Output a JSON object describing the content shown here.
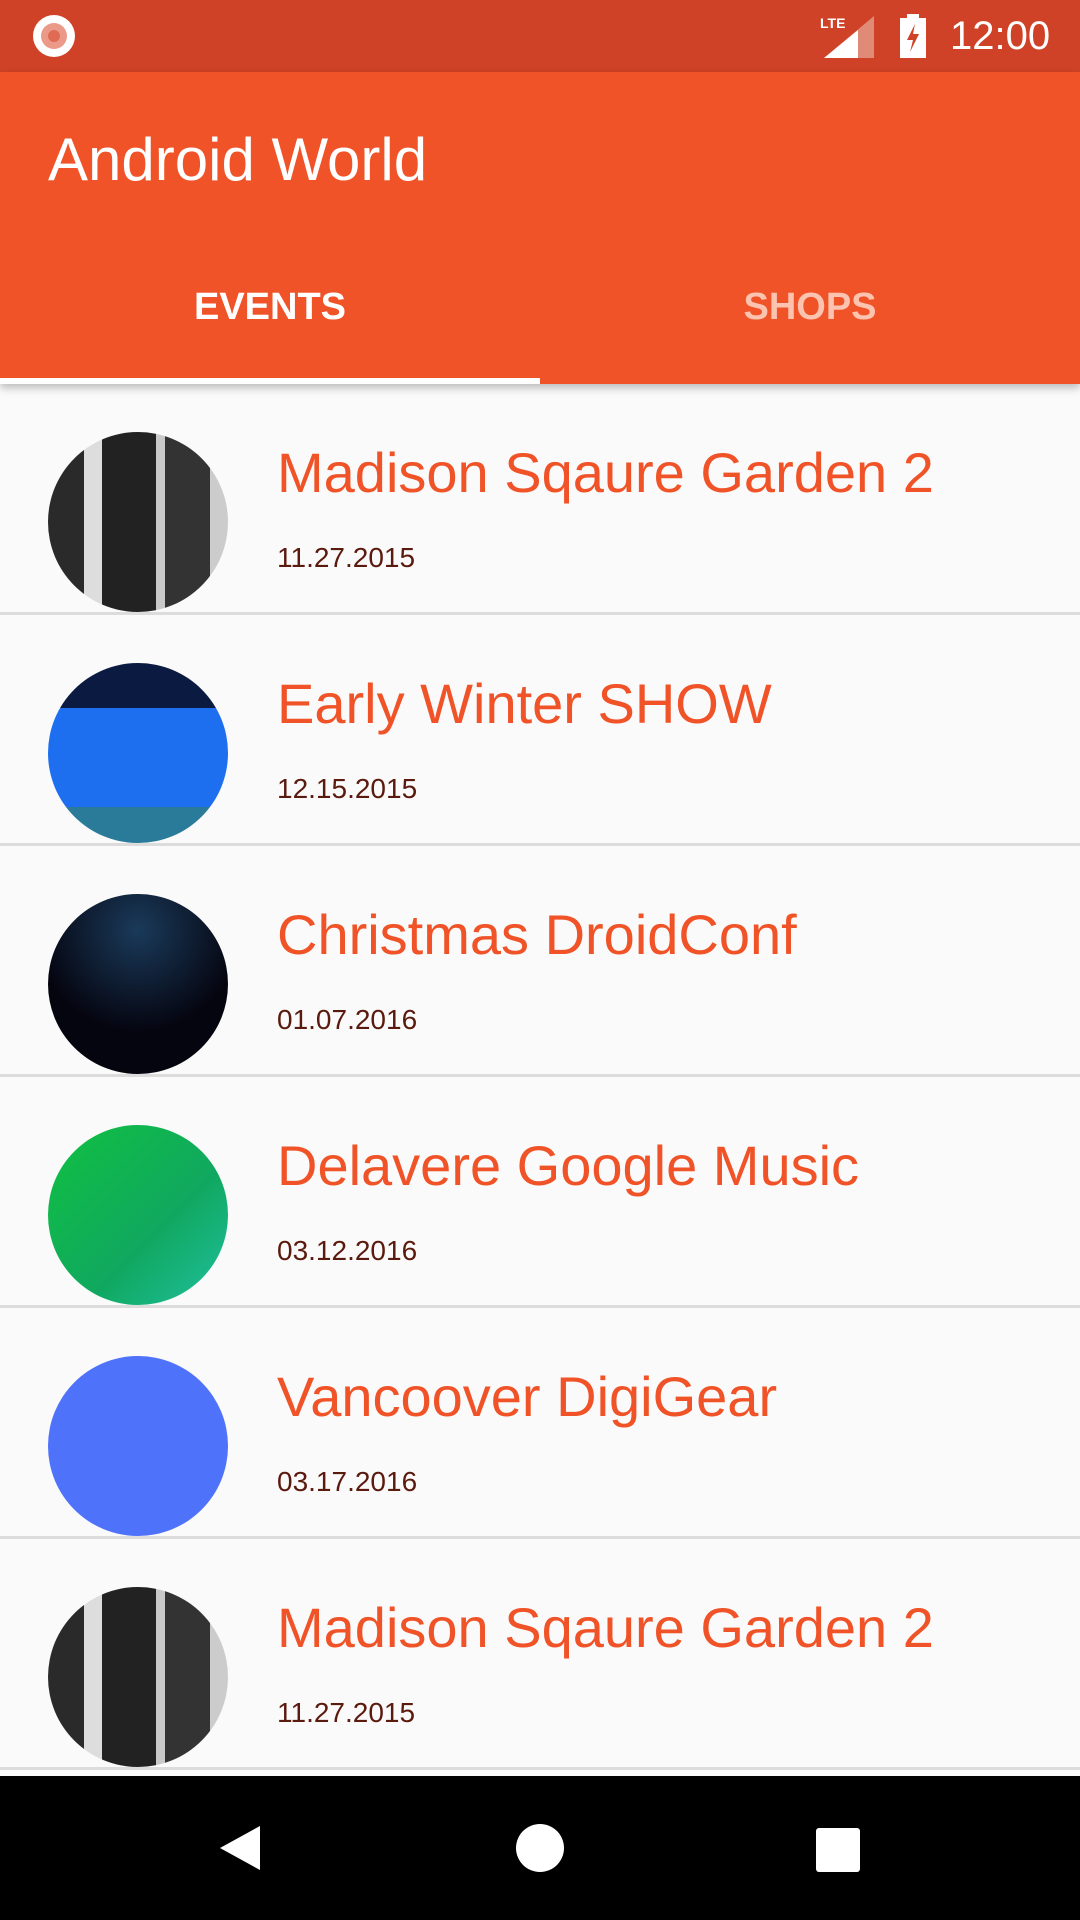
{
  "status_bar": {
    "time": "12:00",
    "network": "LTE",
    "icons": [
      "record-icon",
      "lte-signal-icon",
      "battery-charging-icon"
    ]
  },
  "app_bar": {
    "title": "Android World",
    "color": "#f05327"
  },
  "tabs": [
    {
      "label": "EVENTS",
      "selected": true
    },
    {
      "label": "SHOPS",
      "selected": false
    }
  ],
  "events": [
    {
      "title": "Madison Sqaure Garden 2",
      "date": "11.27.2015",
      "image": "people-photo"
    },
    {
      "title": "Early Winter SHOW",
      "date": "12.15.2015",
      "image": "stage-photo"
    },
    {
      "title": "Christmas DroidConf",
      "date": "01.07.2016",
      "image": "whats-next-photo"
    },
    {
      "title": "Delavere Google Music",
      "date": "03.12.2016",
      "image": "ng-conf-logo"
    },
    {
      "title": "Vancoover DigiGear",
      "date": "03.17.2016",
      "image": "io-logo"
    },
    {
      "title": "Madison Sqaure Garden 2",
      "date": "11.27.2015",
      "image": "people-photo"
    }
  ],
  "nav_bar": {
    "icons": [
      "back-icon",
      "home-icon",
      "recents-icon"
    ]
  }
}
